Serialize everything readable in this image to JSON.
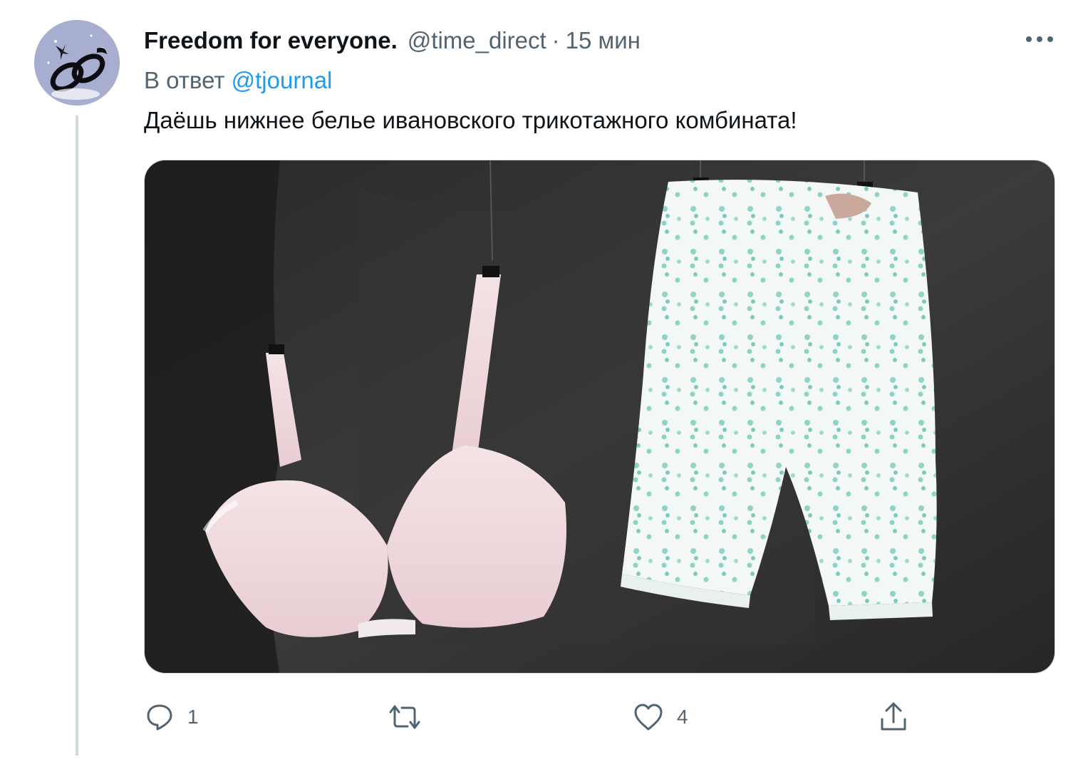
{
  "tweet": {
    "display_name": "Freedom for everyone.",
    "handle": "@time_direct",
    "separator": "·",
    "time": "15 мин",
    "reply_prefix": "В ответ",
    "reply_to": "@tjournal",
    "text": "Даёшь нижнее белье ивановского трикотажного комбината!",
    "media_description_icon": "photo-of-vintage-underwear"
  },
  "actions": {
    "reply_count": "1",
    "retweet_count": "",
    "like_count": "4",
    "share_label": ""
  },
  "colors": {
    "text_primary": "#0f1419",
    "text_secondary": "#536471",
    "link": "#1d9bf0",
    "thread_line": "#cfd9de"
  }
}
